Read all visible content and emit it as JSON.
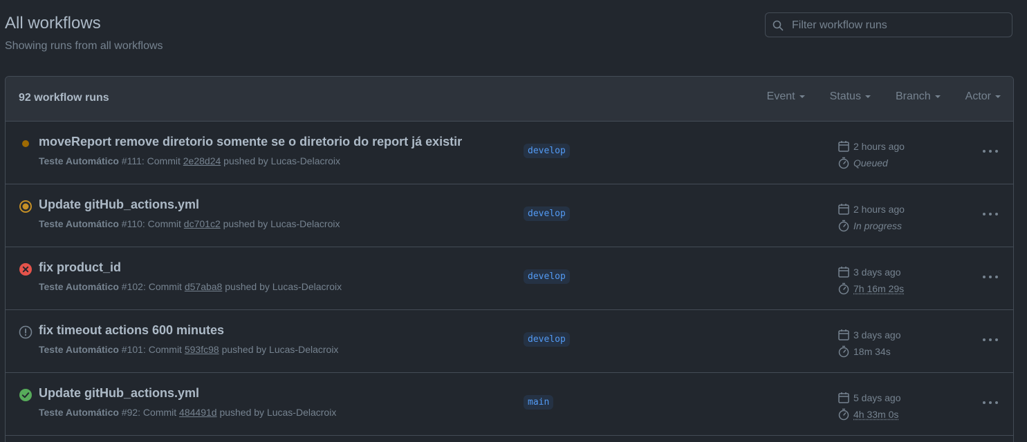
{
  "header": {
    "title": "All workflows",
    "subtitle": "Showing runs from all workflows"
  },
  "search": {
    "placeholder": "Filter workflow runs",
    "value": ""
  },
  "runs_box": {
    "count_label": "92 workflow runs",
    "filters": [
      "Event",
      "Status",
      "Branch",
      "Actor"
    ]
  },
  "runs": [
    {
      "status": "queued",
      "title": "moveReport remove diretorio somente se o diretorio do report já existir",
      "workflow": "Teste Automático",
      "run_ref": "#111: Commit",
      "sha": "2e28d24",
      "pushed_by": "pushed by Lucas-Delacroix",
      "branch": "develop",
      "when": "2 hours ago",
      "duration": "Queued"
    },
    {
      "status": "in-progress",
      "title": "Update gitHub_actions.yml",
      "workflow": "Teste Automático",
      "run_ref": "#110: Commit",
      "sha": "dc701c2",
      "pushed_by": "pushed by Lucas-Delacroix",
      "branch": "develop",
      "when": "2 hours ago",
      "duration": "In progress"
    },
    {
      "status": "failure",
      "title": "fix product_id",
      "workflow": "Teste Automático",
      "run_ref": "#102: Commit",
      "sha": "d57aba8",
      "pushed_by": "pushed by Lucas-Delacroix",
      "branch": "develop",
      "when": "3 days ago",
      "duration": "7h 16m 29s"
    },
    {
      "status": "cancelled",
      "title": "fix timeout actions 600 minutes",
      "workflow": "Teste Automático",
      "run_ref": "#101: Commit",
      "sha": "593fc98",
      "pushed_by": "pushed by Lucas-Delacroix",
      "branch": "develop",
      "when": "3 days ago",
      "duration": "18m 34s"
    },
    {
      "status": "success",
      "title": "Update gitHub_actions.yml",
      "workflow": "Teste Automático",
      "run_ref": "#92: Commit",
      "sha": "484491d",
      "pushed_by": "pushed by Lucas-Delacroix",
      "branch": "main",
      "when": "5 days ago",
      "duration": "4h 33m 0s"
    }
  ],
  "colors": {
    "background": "#22272e",
    "header_bg": "#2d333b",
    "queued": "#c69026",
    "failure": "#e5534b",
    "success": "#57ab5a",
    "branch_text": "#539bf5"
  }
}
